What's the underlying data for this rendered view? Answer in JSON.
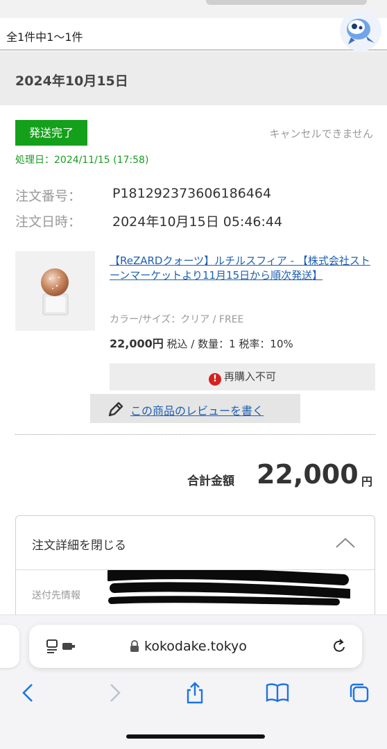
{
  "header": {
    "result_count": "全1件中1〜1件"
  },
  "order_group": {
    "date": "2024年10月15日"
  },
  "order": {
    "status": "発送完了",
    "cancel_note": "キャンセルできません",
    "processed": "処理日：2024/11/15 (17:58)",
    "number_label": "注文番号：",
    "number": "P181292373606186464",
    "datetime_label": "注文日時：",
    "datetime": "2024年10月15日 05:46:44"
  },
  "product": {
    "title": "【ReZARDクォーツ】ルチルスフィア - 【株式会社ストーンマーケットより11月15日から順次発送】",
    "variant": "カラー/サイズ：クリア / FREE",
    "price": "22,000円",
    "price_detail": " 税込 / 数量：1 税率：10%",
    "rebuy_status": "再購入不可",
    "review_label": "この商品のレビューを書く"
  },
  "summary": {
    "total_label": "合計金額",
    "total_amount": "22,000",
    "total_unit": "円"
  },
  "details": {
    "toggle_label": "注文詳細を閉じる",
    "shipping_label": "送付先情報"
  },
  "browser": {
    "url": "kokodake.tokyo"
  },
  "icons": {
    "alert": "!",
    "mascot": "mascot-icon",
    "pen": "pen-icon",
    "chevron": "chevron-up-icon",
    "lock": "lock-icon",
    "reader": "reader-mode-icon",
    "reload": "reload-icon",
    "back": "back-arrow-icon",
    "forward": "forward-arrow-icon",
    "share": "share-icon",
    "bookmarks": "bookmarks-icon",
    "tabs": "tabs-icon"
  },
  "colors": {
    "status_green": "#14a01a",
    "link_blue": "#1d5fb0",
    "ios_blue": "#1a73e8",
    "alert_red": "#d62020"
  }
}
